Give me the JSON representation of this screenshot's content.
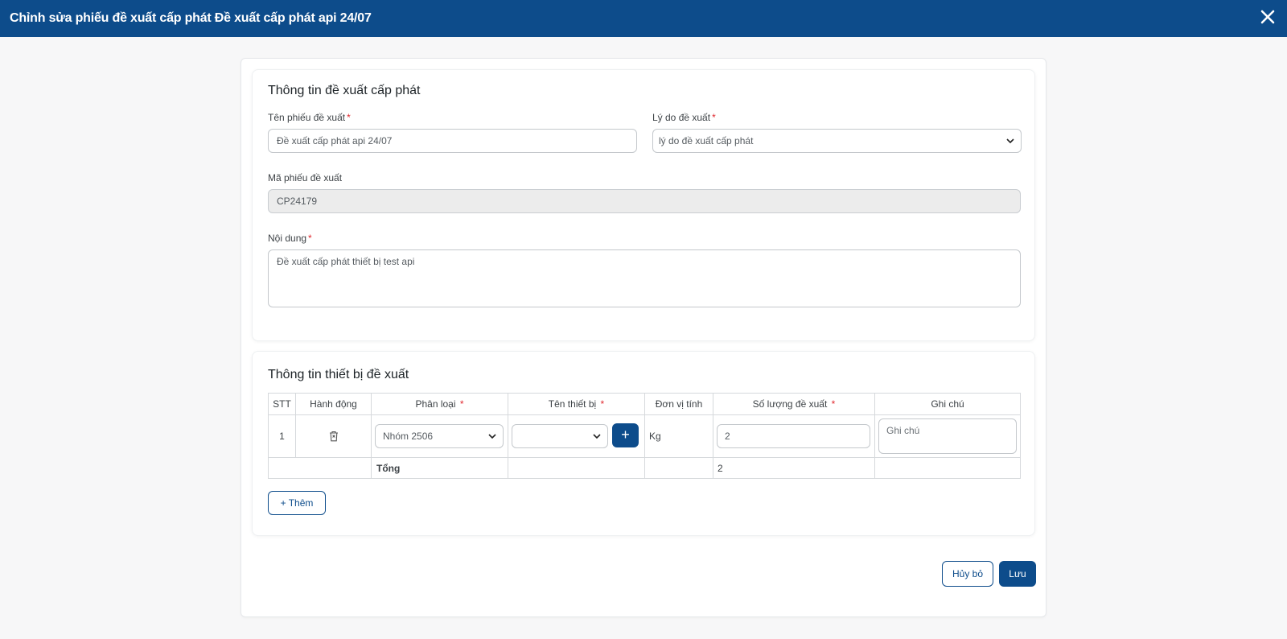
{
  "header": {
    "title": "Chỉnh sửa phiếu đề xuất cấp phát Đề xuất cấp phát api 24/07",
    "close_icon": "close-icon"
  },
  "info_section": {
    "title": "Thông tin đề xuất cấp phát",
    "name_label": "Tên phiếu đề xuất",
    "name_value": "Đề xuất cấp phát api 24/07",
    "reason_label": "Lý do đề xuất",
    "reason_value": "lý do đề xuất cấp phát",
    "code_label": "Mã phiếu đề xuất",
    "code_value": "CP24179",
    "content_label": "Nội dung",
    "content_value": "Đề xuất cấp phát thiết bị test api",
    "required_mark": "*"
  },
  "device_section": {
    "title": "Thông tin thiết bị đề xuất",
    "columns": {
      "stt": "STT",
      "action": "Hành động",
      "category": "Phân loại",
      "device_name": "Tên thiết bị",
      "unit": "Đơn vị tính",
      "quantity": "Số lượng đề xuất",
      "note": "Ghi chú"
    },
    "rows": [
      {
        "stt": "1",
        "category": "Nhóm 2506",
        "device_name": "",
        "unit": "Kg",
        "quantity": "2",
        "note_placeholder": "Ghi chú"
      }
    ],
    "total_label": "Tổng",
    "total_quantity": "2",
    "add_plus": "+",
    "add_button": "+ Thêm"
  },
  "footer": {
    "cancel_label": "Hủy bỏ",
    "save_label": "Lưu"
  },
  "colors": {
    "primary": "#0d4c8b",
    "required": "#e0282e"
  }
}
